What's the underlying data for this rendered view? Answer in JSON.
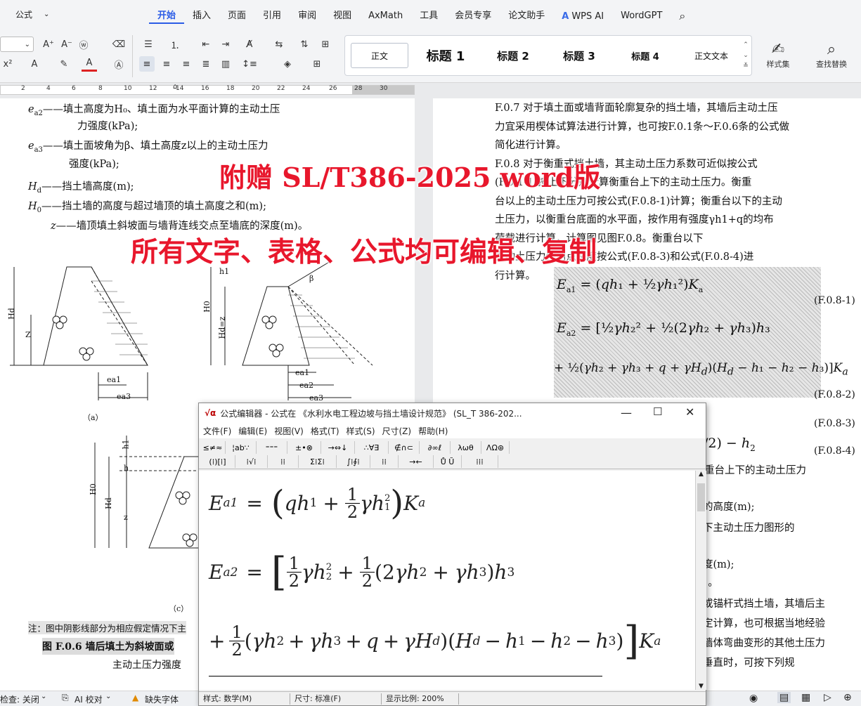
{
  "app": {
    "style_combo": "公式",
    "menu": [
      "开始",
      "插入",
      "页面",
      "引用",
      "审阅",
      "视图",
      "AxMath",
      "工具",
      "会员专享",
      "论文助手",
      "WPS AI",
      "WordGPT"
    ],
    "active_menu": "开始",
    "styles": [
      "正文",
      "标题 1",
      "标题 2",
      "标题 3",
      "标题 4",
      "正文文本"
    ],
    "style_set_label": "样式集",
    "find_replace_label": "查找替换",
    "accent_color": "#2b5ce6",
    "ruler_numbers": [
      "2",
      "4",
      "6",
      "8",
      "10",
      "12",
      "14",
      "16",
      "18",
      "20",
      "22",
      "24",
      "26",
      "28",
      "30"
    ]
  },
  "left_page": {
    "lines": [
      {
        "sym": "e",
        "sub": "a2",
        "text": "——填土高度为H₀、填土面为水平面计算的主动土压"
      },
      {
        "sym": "",
        "sub": "",
        "text": "力强度(kPa);"
      },
      {
        "sym": "e",
        "sub": "a3",
        "text": "——填土面坡角为β、填土高度z以上的主动土压力"
      },
      {
        "sym": "",
        "sub": "",
        "text": "强度(kPa);"
      },
      {
        "sym": "H",
        "sub": "d",
        "text": "——挡土墙高度(m);"
      },
      {
        "sym": "H",
        "sub": "0",
        "text": "——挡土墙的高度与超过墙顶的填土高度之和(m);"
      },
      {
        "sym": "z",
        "sub": "",
        "text": "——墙顶填土斜坡面与墙背连线交点至墙底的深度(m)。"
      }
    ],
    "fig_labels": {
      "a": "（a）",
      "c": "（c）",
      "Hd": "Hd",
      "Z": "Z",
      "H0": "H0",
      "Hd_eq_z": "Hd=z",
      "h1": "h1",
      "h": "h",
      "z": "z",
      "beta": "β",
      "ea1": "ea1",
      "ea2": "ea2",
      "ea3": "ea3"
    },
    "note": "注：图中阴影线部分为相应假定情况下主",
    "caption_1": "图 F.0.6  墙后填土为斜坡面或",
    "caption_2": "主动土压力强度"
  },
  "right_page": {
    "lines": [
      "F.0.7  对于填土面或墙背面轮廓复杂的挡土墙，其墙后主动土压",
      "力宜采用楔体试算法进行计算，也可按F.0.1条～F.0.6条的公式做",
      "简化进行计算。",
      "F.0.8  对于衡重式挡土墙，其主动土压力系数可近似按公式",
      "(F.0.1-1)按上下分别计算衡重台上下的主动土压力。衡重",
      "台以上的主动土压力可按公式(F.0.8-1)计算；衡重台以下的主动",
      "土压力，以衡重台底面的水平面，按作用有强度γh1+q的均布",
      "荷载进行计算，计算图见图F.0.8。衡重台以下",
      "主动土压力作用点深度按公式(F.0.8-3)和公式(F.0.8-4)进",
      "行计算。"
    ],
    "eq_nums": [
      "(F.0.8-1)",
      "(F.0.8-2)",
      "(F.0.8-3)",
      "(F.0.8-4)"
    ],
    "frag_lines": [
      "重台上下的主动土压力",
      "的高度(m);",
      "下主动土压力图形的",
      ";",
      "度(m);",
      "）。",
      "或锚杆式挡土墙，其墙后主",
      "定计算，也可根据当地经验",
      "墙体弯曲变形的其他土压力",
      "垂直时，可按下列规"
    ]
  },
  "overlay": {
    "line1": "附赠  SL/T386-2025 word版",
    "line2": "所有文字、表格、公式均可编辑、复制",
    "color": "#e8172c"
  },
  "status": {
    "check": "检查: 关闭",
    "ai_check": "AI 校对",
    "missing_font": "缺失字体"
  },
  "editor": {
    "title": "公式编辑器 - 公式在 《水利水电工程边坡与挡土墙设计规范》 (SL_T 386-202...",
    "menu": [
      "文件(F)",
      "编辑(E)",
      "视图(V)",
      "格式(T)",
      "样式(S)",
      "尺寸(Z)",
      "帮助(H)"
    ],
    "tb_row1": [
      "≤≠≈",
      "¦ab∵",
      "⁼⁼⁼",
      "±•⊗",
      "→⇔↓",
      "∴∀∃",
      "∉∩⊂",
      "∂∞ℓ",
      "λωθ",
      "ΛΩ⊛"
    ],
    "tb_row2": [
      "(⁞)[⁞]",
      "⁞√⁞",
      "⁞⁞",
      "Σ⁞Σ⁞",
      "∫⁞∮⁞",
      "⁞⁞",
      "→←",
      "Ů Ŭ",
      "⁞⁞⁞"
    ],
    "status": [
      "样式: 数学(M)",
      "尺寸: 标准(F)",
      "显示比例: 200%"
    ],
    "eq1": {
      "lhs_sym": "E",
      "lhs_sub": "a1"
    },
    "eq2": {
      "lhs_sym": "E",
      "lhs_sub": "a2"
    }
  }
}
